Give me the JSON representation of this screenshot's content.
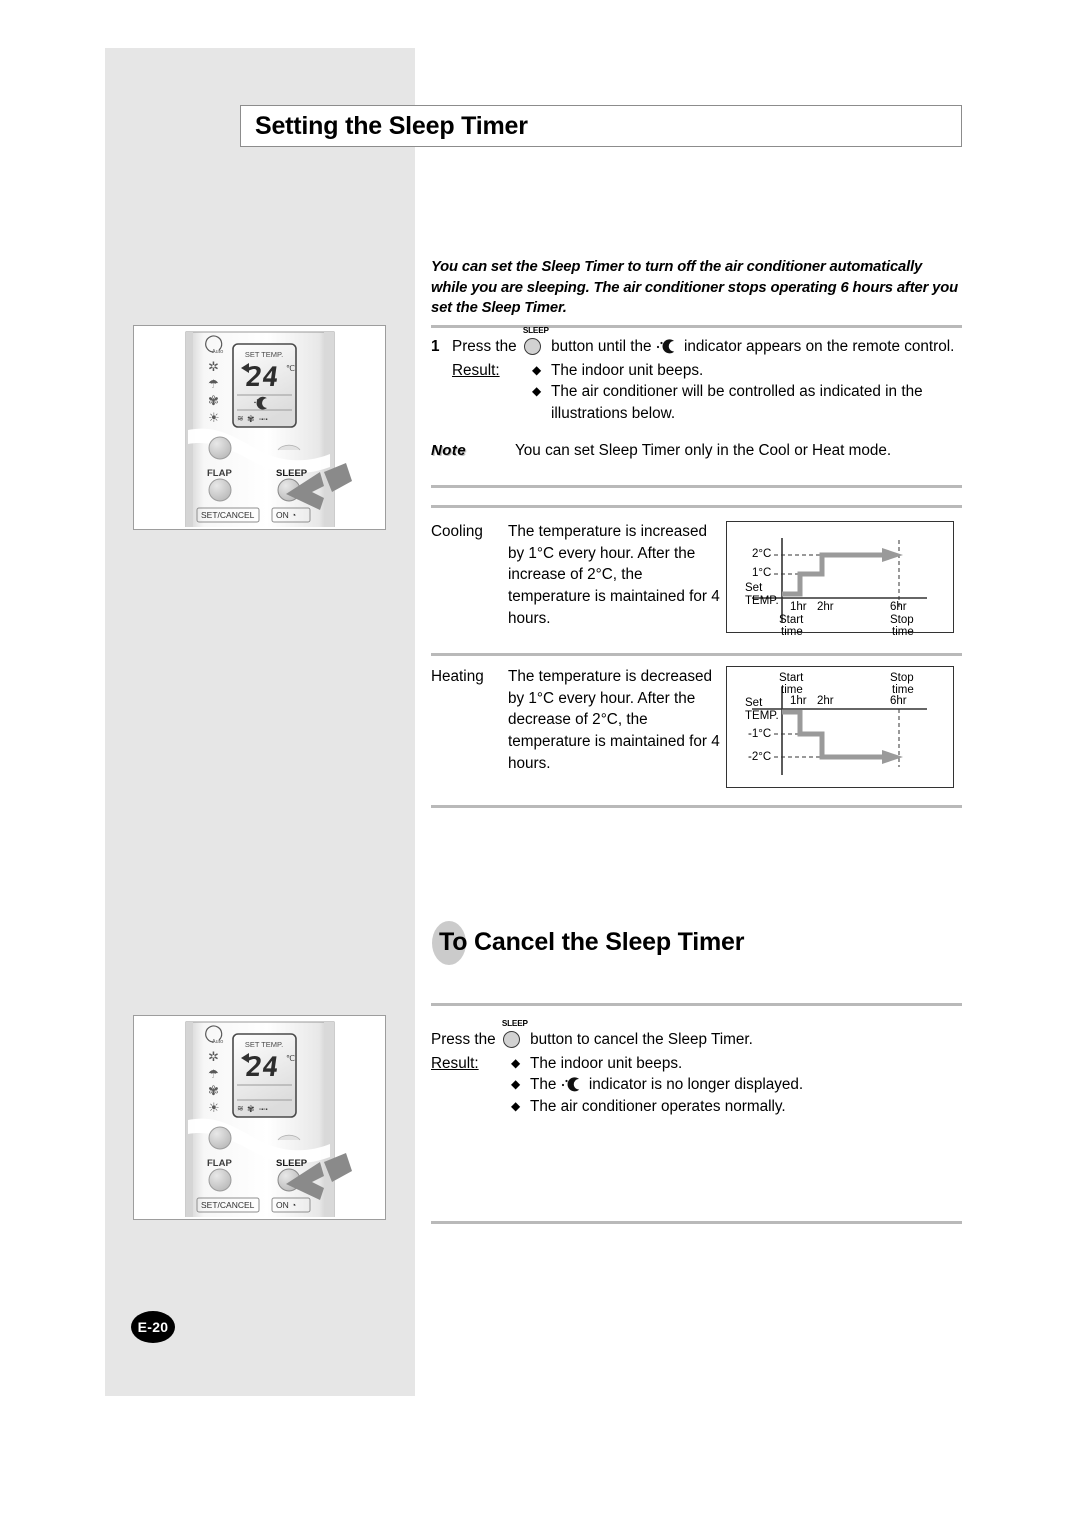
{
  "page": {
    "title": "Setting the Sleep Timer",
    "page_number": "E-20"
  },
  "intro": "You can set the Sleep Timer to turn off the air conditioner automatically while you are sleeping. The air conditioner stops operating 6 hours after you set the Sleep Timer.",
  "step1": {
    "number": "1",
    "text_before_button": "Press the",
    "button_label": "SLEEP",
    "text_between": "button until the",
    "text_after_icon": "indicator appears on the remote control.",
    "result_label": "Result:",
    "bullets": [
      "The indoor unit beeps.",
      "The air conditioner will be controlled as indicated in the illustrations below."
    ]
  },
  "note": {
    "label": "Note",
    "text": "You can set Sleep Timer only in the Cool or Heat mode."
  },
  "modes": [
    {
      "label": "Cooling",
      "text": "The temperature is increased by 1°C every hour. After the increase of 2°C, the temperature is maintained for 4 hours."
    },
    {
      "label": "Heating",
      "text": "The temperature is decreased by 1°C every hour. After the decrease of 2°C, the temperature is maintained for 4 hours."
    }
  ],
  "chart_data": [
    {
      "type": "line",
      "title": "Cooling sleep timer temperature profile",
      "ylabel": "Set TEMP.",
      "xlabel": "",
      "axis_origin_label": "Set\nTEMP.",
      "axis_origin_line1": "Set",
      "axis_origin_line2": "TEMP.",
      "ytick_labels": [
        "1°C",
        "2°C"
      ],
      "ytick_values": [
        1,
        2
      ],
      "xtick_labels": [
        "1hr",
        "2hr",
        "6hr"
      ],
      "xtick_values": [
        1,
        2,
        6
      ],
      "start_label_line1": "Start",
      "start_label_line2": "time",
      "stop_label_line1": "Stop",
      "stop_label_line2": "time",
      "x": [
        0,
        1,
        1,
        2,
        2,
        6
      ],
      "values": [
        0,
        0,
        1,
        1,
        2,
        2
      ],
      "ylim": [
        0,
        2.6
      ],
      "xlim": [
        0,
        6.6
      ],
      "grid": false,
      "dashed_guides": [
        "1°C",
        "2°C",
        "6hr"
      ],
      "arrow_at_end": true
    },
    {
      "type": "line",
      "title": "Heating sleep timer temperature profile",
      "ylabel": "Set TEMP.",
      "xlabel": "",
      "axis_origin_line1": "Set",
      "axis_origin_line2": "TEMP.",
      "ytick_labels": [
        "-1°C",
        "-2°C"
      ],
      "ytick_values": [
        -1,
        -2
      ],
      "xtick_labels": [
        "1hr",
        "2hr",
        "6hr"
      ],
      "xtick_values": [
        1,
        2,
        6
      ],
      "start_label_line1": "Start",
      "start_label_line2": "time",
      "stop_label_line1": "Stop",
      "stop_label_line2": "time",
      "x": [
        0,
        1,
        1,
        2,
        2,
        6
      ],
      "values": [
        0,
        0,
        -1,
        -1,
        -2,
        -2
      ],
      "ylim": [
        -2.6,
        0.4
      ],
      "xlim": [
        0,
        6.6
      ],
      "grid": false,
      "dashed_guides": [
        "-1°C",
        "-2°C",
        "6hr"
      ],
      "arrow_at_end": true
    }
  ],
  "cancel": {
    "heading_prefix": "To",
    "heading_rest": "Cancel the Sleep Timer",
    "text_before_button": "Press the",
    "button_label": "SLEEP",
    "text_after_button": "button to cancel the Sleep Timer.",
    "result_label": "Result:",
    "bullets_1": "The indoor unit beeps.",
    "bullets_2_pre": "The",
    "bullets_2_post": "indicator is no longer displayed.",
    "bullets_3": "The air conditioner operates normally."
  },
  "remote": {
    "display_title": "SET TEMP.",
    "temperature": "24",
    "unit": "℃",
    "mode_icons": [
      "auto-icon",
      "snowflake-icon",
      "dehumidify-icon",
      "fan-icon",
      "sun-icon"
    ],
    "buttons": {
      "flap": "FLAP",
      "sleep": "SLEEP",
      "set_cancel": "SET/CANCEL",
      "on_timer": "ON"
    }
  }
}
